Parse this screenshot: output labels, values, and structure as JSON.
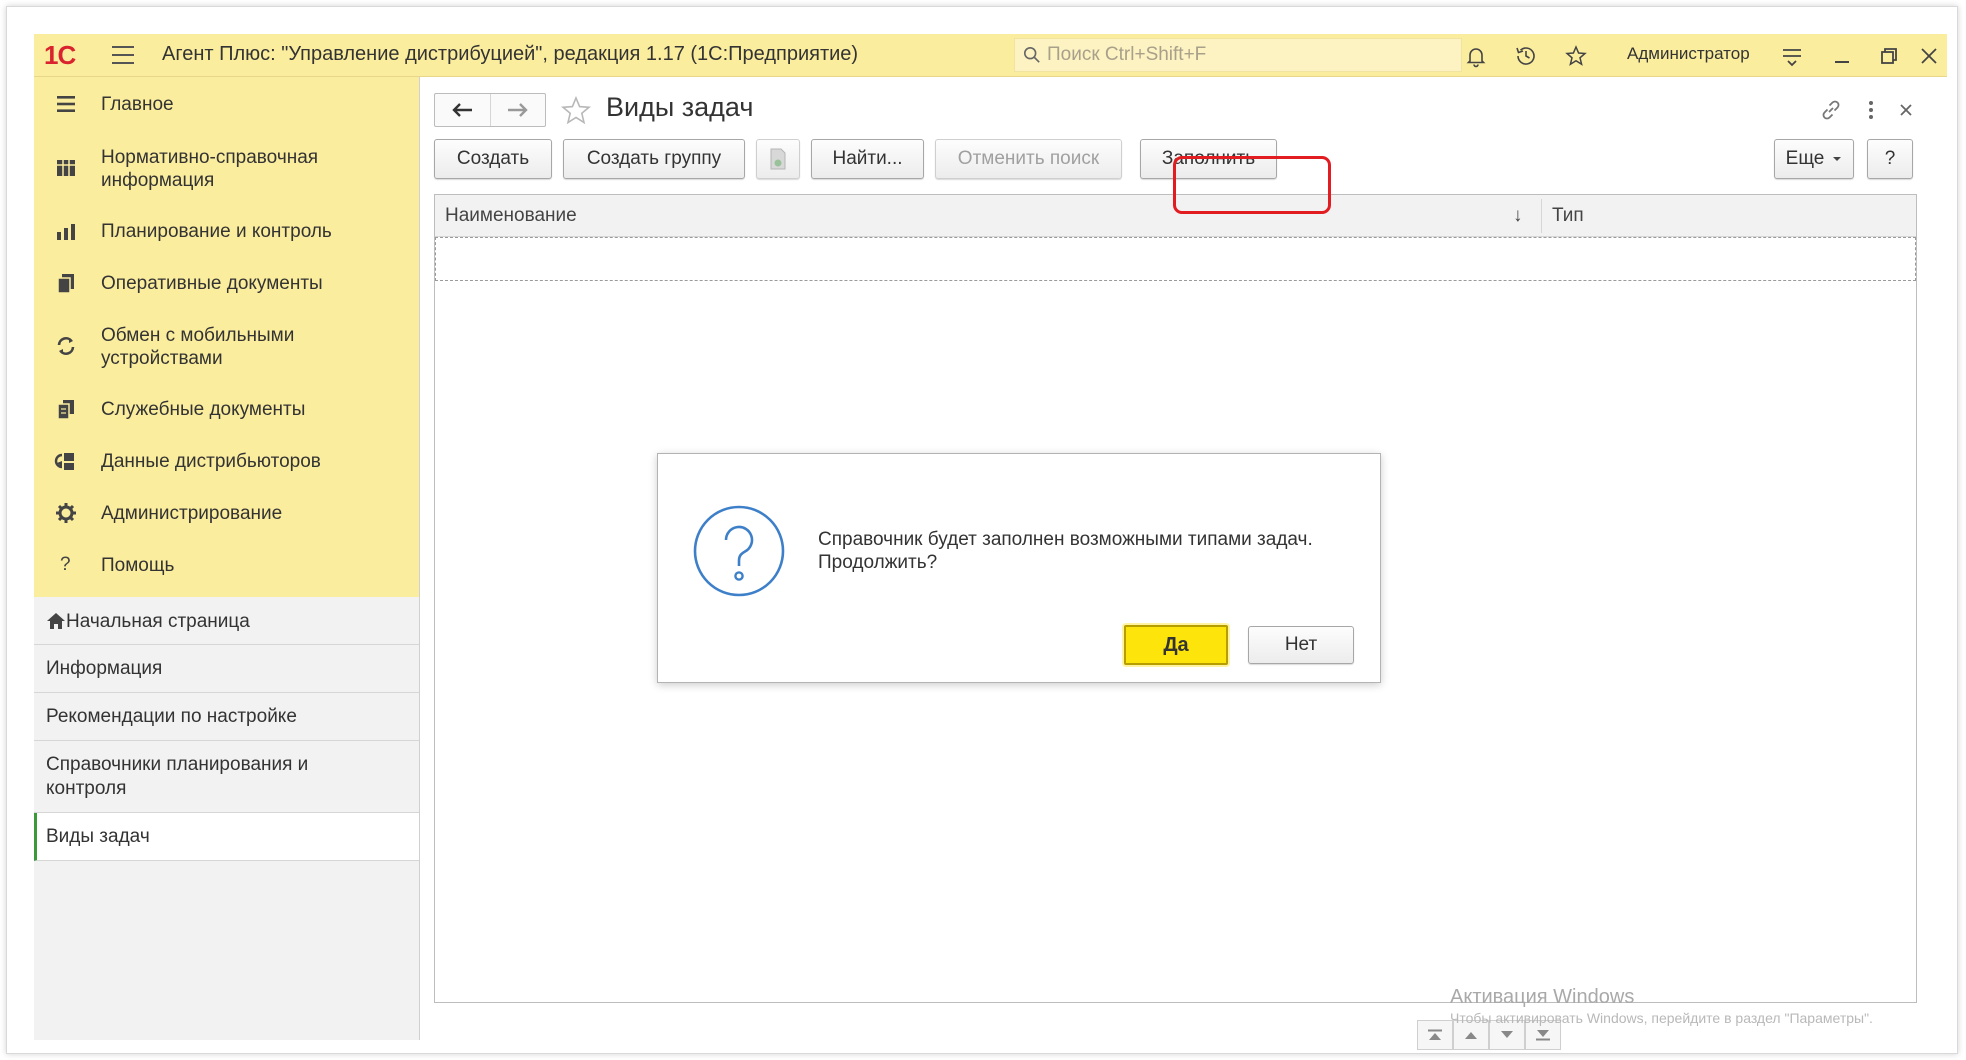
{
  "titlebar": {
    "logo": "1С",
    "app_title": "Агент Плюс: \"Управление дистрибуцией\", редакция 1.17  (1С:Предприятие)",
    "search_placeholder": "Поиск Ctrl+Shift+F",
    "user": "Администратор",
    "icons": [
      "hamburger-icon",
      "bell-icon",
      "history-icon",
      "star-icon",
      "settings-lines-icon",
      "minimize-icon",
      "restore-icon",
      "close-icon"
    ]
  },
  "sidebar": {
    "menu": [
      {
        "label": "Главное",
        "icon": "list-icon"
      },
      {
        "label": "Нормативно-справочная информация",
        "icon": "grid-icon"
      },
      {
        "label": "Планирование и контроль",
        "icon": "bar-chart-icon"
      },
      {
        "label": "Оперативные документы",
        "icon": "documents-icon"
      },
      {
        "label": "Обмен с мобильными устройствами",
        "icon": "sync-icon"
      },
      {
        "label": "Служебные документы",
        "icon": "service-documents-icon"
      },
      {
        "label": "Данные дистрибьюторов",
        "icon": "distributor-icon"
      },
      {
        "label": "Администрирование",
        "icon": "gear-icon"
      },
      {
        "label": "Помощь",
        "icon": "question-icon"
      }
    ],
    "nav": [
      {
        "label": "Начальная страница",
        "icon": "home-icon"
      },
      {
        "label": "Информация"
      },
      {
        "label": "Рекомендации по настройке"
      },
      {
        "label": "Справочники планирования и контроля"
      },
      {
        "label": "Виды задач",
        "active": true
      }
    ]
  },
  "form": {
    "title": "Виды задач",
    "toolbar": {
      "create": "Создать",
      "create_group": "Создать группу",
      "find": "Найти...",
      "cancel_search": "Отменить поиск",
      "fill": "Заполнить",
      "more": "Еще",
      "help": "?"
    },
    "table": {
      "columns": [
        "Наименование",
        "Тип"
      ],
      "sort_indicator": "↓",
      "rows": []
    }
  },
  "dialog": {
    "message": "Справочник будет заполнен возможными типами задач. Продолжить?",
    "yes": "Да",
    "no": "Нет"
  },
  "watermark": {
    "title": "Активация Windows",
    "subtitle": "Чтобы активировать Windows, перейдите в раздел \"Параметры\"."
  },
  "colors": {
    "accent_yellow": "#fbed9e",
    "highlight_red": "#e21d22",
    "yes_button": "#fde50b",
    "active_marker": "#3a9a3a"
  }
}
